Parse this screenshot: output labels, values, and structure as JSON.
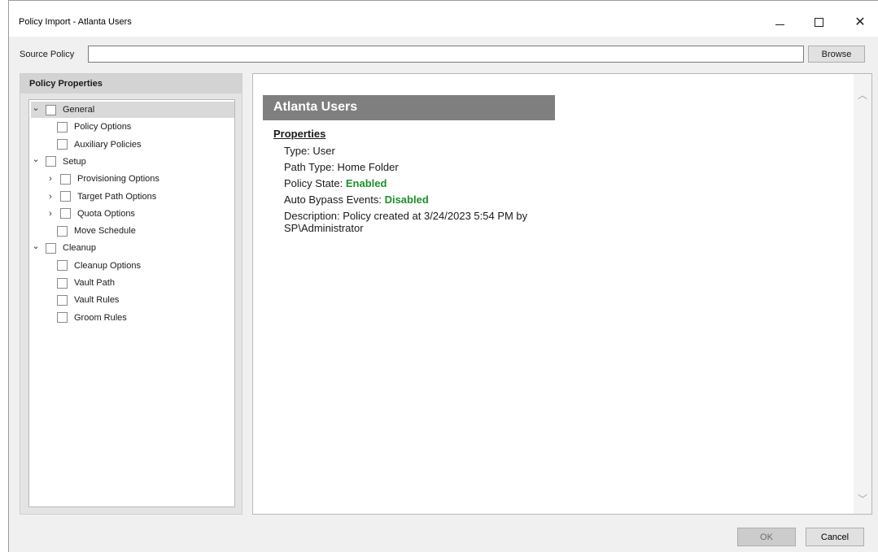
{
  "window": {
    "title": "Policy Import - Atlanta Users",
    "controls": {
      "minimize": "minimize-icon",
      "maximize": "maximize-icon",
      "close": "close-icon"
    }
  },
  "source": {
    "label": "Source Policy",
    "value": "",
    "browse_label": "Browse"
  },
  "left_panel": {
    "header": "Policy Properties",
    "tree": [
      {
        "label": "General",
        "expander": "expanded",
        "selected": true
      },
      {
        "label": "Policy Options",
        "expander": "none"
      },
      {
        "label": "Auxiliary Policies",
        "expander": "none"
      },
      {
        "label": "Setup",
        "expander": "expanded"
      },
      {
        "label": "Provisioning Options",
        "expander": "collapsed"
      },
      {
        "label": "Target Path Options",
        "expander": "collapsed"
      },
      {
        "label": "Quota Options",
        "expander": "collapsed"
      },
      {
        "label": "Move Schedule",
        "expander": "none"
      },
      {
        "label": "Cleanup",
        "expander": "expanded"
      },
      {
        "label": "Cleanup Options",
        "expander": "none"
      },
      {
        "label": "Vault Path",
        "expander": "none"
      },
      {
        "label": "Vault Rules",
        "expander": "none"
      },
      {
        "label": "Groom Rules",
        "expander": "none"
      }
    ]
  },
  "details": {
    "banner": "Atlanta Users",
    "section_title": "Properties",
    "type_label": "Type: ",
    "type_value": "User",
    "path_type_label": "Path Type: ",
    "path_type_value": "Home Folder",
    "state_label": "Policy State: ",
    "state_value": "Enabled",
    "bypass_label": "Auto Bypass Events: ",
    "bypass_value": "Disabled",
    "description_label": "Description: ",
    "description_value": "Policy created at 3/24/2023 5:54 PM by SP\\Administrator",
    "status_color": "#1f8f2a"
  },
  "footer": {
    "ok_label": "OK",
    "cancel_label": "Cancel"
  }
}
